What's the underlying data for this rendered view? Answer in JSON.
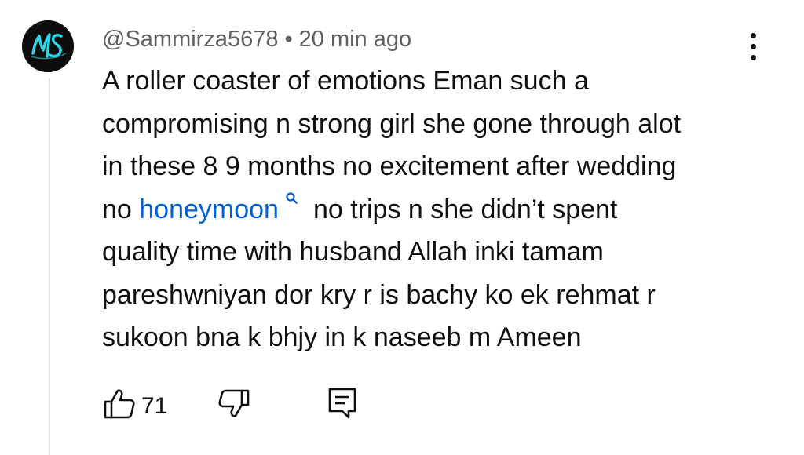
{
  "comment": {
    "avatar_icon": "ms-monogram-avatar",
    "author": "@Sammirza5678",
    "separator": "•",
    "time": "20 min ago",
    "more_icon": "vertical-dots-icon",
    "text_line1": "A roller coaster of emotions Eman such a",
    "text_line2": "compromising n strong girl she gone through alot",
    "text_line3": "in these 8 9 months no excitement after wedding",
    "text_line4_pre": "no ",
    "text_line4_link": "honeymoon",
    "text_line4_post": "no trips n she didn’t spent",
    "text_line5": "quality time with husband Allah inki tamam",
    "text_line6": "pareshwniyan dor kry r is bachy ko ek rehmat r",
    "text_line7": "sukoon bna k bhjy in k naseeb m Ameen",
    "like_count": "71",
    "link_color": "#065fd4",
    "meta_color": "#606060"
  }
}
